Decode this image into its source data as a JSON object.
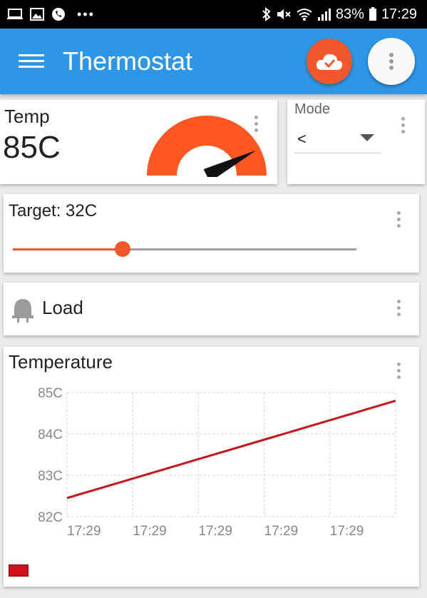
{
  "status_bar": {
    "battery": "83%",
    "time": "17:29",
    "icons": [
      "laptop-icon",
      "image-icon",
      "phone-icon",
      "more-dots-icon",
      "bluetooth-icon",
      "mute-icon",
      "wifi-icon",
      "signal-icon",
      "battery-icon"
    ]
  },
  "app_bar": {
    "title": "Thermostat",
    "icons": [
      "menu-icon",
      "cloud-check-icon",
      "more-vert-icon"
    ],
    "accent_color": "#2f96e6",
    "action_color": "#f2582b"
  },
  "temp_card": {
    "label": "Temp",
    "value": "85C",
    "gauge_fraction": 0.85,
    "gauge_color": "#ff5722"
  },
  "mode_card": {
    "label": "Mode",
    "selected": "<"
  },
  "target_card": {
    "label": "Target: 32C",
    "slider_fraction": 0.32,
    "slider_color": "#f2582b"
  },
  "load_card": {
    "label": "Load",
    "icon": "plug-icon"
  },
  "chart_card": {
    "title": "Temperature"
  },
  "chart_data": {
    "type": "line",
    "title": "Temperature",
    "y_ticks": [
      "85C",
      "84C",
      "83C",
      "82C"
    ],
    "x_ticks": [
      "17:29",
      "17:29",
      "17:29",
      "17:29",
      "17:29"
    ],
    "ylim": [
      82,
      85
    ],
    "grid": true,
    "series": [
      {
        "color": "#c8141e",
        "points": [
          [
            0,
            82.45
          ],
          [
            5,
            84.8
          ]
        ]
      }
    ]
  }
}
